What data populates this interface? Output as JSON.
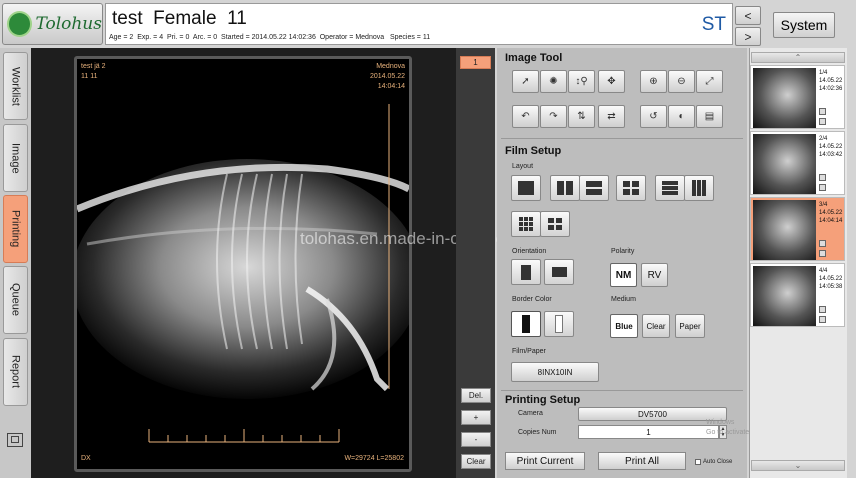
{
  "brand": {
    "logo_text": "Tolohus"
  },
  "header": {
    "patient_title": "test  Female  11",
    "patient_info": "Age = 2  Exp. = 4  Pri. = 0  Arc. = 0  Started = 2014.05.22 14:02:36  Operator = Mednova   Species = 11",
    "modality": "ST",
    "prev_label": "<",
    "next_label": ">",
    "system_label": "System"
  },
  "sidebar": {
    "tabs": [
      {
        "label": "Worklist"
      },
      {
        "label": "Image"
      },
      {
        "label": "Printing"
      },
      {
        "label": "Queue"
      },
      {
        "label": "Report"
      }
    ],
    "active_tab": "Printing"
  },
  "viewer": {
    "top_left": "test jä 2\n11 11",
    "top_right": "Mednova\n2014.05.22\n14:04:14",
    "bottom_left": "DX",
    "bottom_right": "W=29724 L=25802",
    "watermark": "tolohas.en.made-in-china.com"
  },
  "controls": {
    "page_number": "1",
    "del_label": "Del.",
    "plus_label": "+",
    "minus_label": "-",
    "clear_label": "Clear"
  },
  "panel": {
    "image_tool_title": "Image Tool",
    "film_setup_title": "Film Setup",
    "layout_label": "Layout",
    "orientation_label": "Orientation",
    "polarity_label": "Polarity",
    "polarity_options": [
      "NM",
      "RV"
    ],
    "border_color_label": "Border Color",
    "medium_label": "Medium",
    "medium_options": [
      "Blue",
      "Clear",
      "Paper"
    ],
    "film_paper_label": "Film/Paper",
    "film_size": "8INX10IN",
    "printing_setup_title": "Printing Setup",
    "camera_label": "Camera",
    "camera_value": "DV5700",
    "copies_label": "Copies Num",
    "copies_value": "1",
    "print_current_label": "Print Current",
    "print_all_label": "Print All",
    "auto_close_label": "Auto Close"
  },
  "thumbnails": [
    {
      "info": "1/4\n14.05.22\n14:02:36",
      "selected": false
    },
    {
      "info": "2/4\n14.05.22\n14:03:42",
      "selected": false
    },
    {
      "info": "3/4\n14.05.22\n14:04:14",
      "selected": true
    },
    {
      "info": "4/4\n14.05.22\n14:05:38",
      "selected": false
    }
  ],
  "windows_watermark": "Windows\nGo to activate Windows."
}
